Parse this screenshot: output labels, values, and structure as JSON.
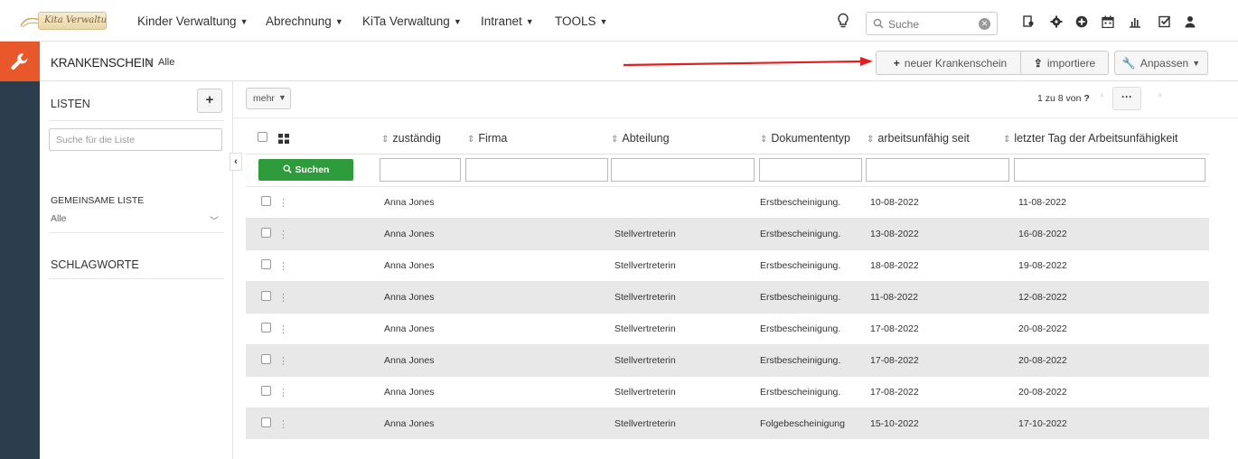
{
  "nav": {
    "logo_text": "Kita Verwaltung",
    "items": [
      {
        "label": "Kinder Verwaltung"
      },
      {
        "label": "Abrechnung"
      },
      {
        "label": "KiTa Verwaltung"
      },
      {
        "label": "Intranet"
      },
      {
        "label": "TOOLS"
      }
    ],
    "search_placeholder": "Suche"
  },
  "breadcrumb": {
    "title": "KRANKENSCHEIN",
    "separator": ">",
    "current": "Alle"
  },
  "toolbar": {
    "new_label": "neuer Krankenschein",
    "import_label": "importiere",
    "customize_label": "Anpassen"
  },
  "sidebar": {
    "lists_title": "LISTEN",
    "list_search_placeholder": "Suche für die Liste",
    "shared_list_title": "GEMEINSAME LISTE",
    "shared_list_value": "Alle",
    "tags_title": "SCHLAGWORTE"
  },
  "table_controls": {
    "more_label": "mehr",
    "pager_text": "1 zu 8  von",
    "pager_unknown": "?",
    "pager_dots": "···",
    "search_button": "Suchen"
  },
  "table": {
    "columns": [
      "zuständig",
      "Firma",
      "Abteilung",
      "Dokumententyp",
      "arbeitsunfähig seit",
      "letzter Tag der Arbeitsunfähigkeit"
    ],
    "rows": [
      {
        "zustaendig": "Anna Jones",
        "firma": "",
        "abteilung": "",
        "dokumententyp": "Erstbescheinigung.",
        "seit": "10-08-2022",
        "letzter": "11-08-2022"
      },
      {
        "zustaendig": "Anna Jones",
        "firma": "",
        "abteilung": "Stellvertreterin",
        "dokumententyp": "Erstbescheinigung.",
        "seit": "13-08-2022",
        "letzter": "16-08-2022"
      },
      {
        "zustaendig": "Anna Jones",
        "firma": "",
        "abteilung": "Stellvertreterin",
        "dokumententyp": "Erstbescheinigung.",
        "seit": "18-08-2022",
        "letzter": "19-08-2022"
      },
      {
        "zustaendig": "Anna Jones",
        "firma": "",
        "abteilung": "Stellvertreterin",
        "dokumententyp": "Erstbescheinigung.",
        "seit": "11-08-2022",
        "letzter": "12-08-2022"
      },
      {
        "zustaendig": "Anna Jones",
        "firma": "",
        "abteilung": "Stellvertreterin",
        "dokumententyp": "Erstbescheinigung.",
        "seit": "17-08-2022",
        "letzter": "20-08-2022"
      },
      {
        "zustaendig": "Anna Jones",
        "firma": "",
        "abteilung": "Stellvertreterin",
        "dokumententyp": "Erstbescheinigung.",
        "seit": "17-08-2022",
        "letzter": "20-08-2022"
      },
      {
        "zustaendig": "Anna Jones",
        "firma": "",
        "abteilung": "Stellvertreterin",
        "dokumententyp": "Erstbescheinigung.",
        "seit": "17-08-2022",
        "letzter": "20-08-2022"
      },
      {
        "zustaendig": "Anna Jones",
        "firma": "",
        "abteilung": "Stellvertreterin",
        "dokumententyp": "Folgebescheinigung",
        "seit": "15-10-2022",
        "letzter": "17-10-2022"
      }
    ]
  },
  "colors": {
    "accent_orange": "#e9582b",
    "rail": "#2c3e4e",
    "search_green": "#2e9c3a",
    "annotation_red": "#e02020"
  }
}
